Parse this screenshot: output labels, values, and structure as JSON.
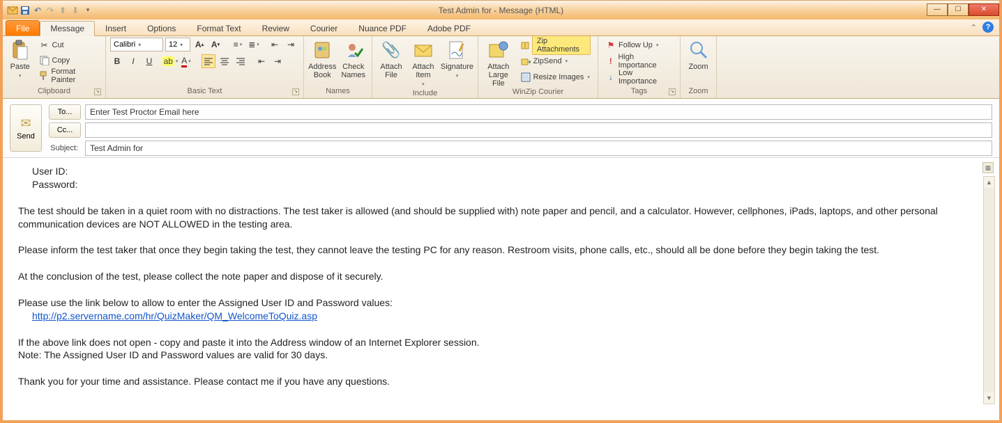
{
  "window": {
    "title": "Test Admin for  - Message (HTML)"
  },
  "tabs": {
    "file": "File",
    "items": [
      "Message",
      "Insert",
      "Options",
      "Format Text",
      "Review",
      "Courier",
      "Nuance PDF",
      "Adobe PDF"
    ],
    "active_index": 0
  },
  "ribbon": {
    "clipboard": {
      "label": "Clipboard",
      "paste": "Paste",
      "cut": "Cut",
      "copy": "Copy",
      "format_painter": "Format Painter"
    },
    "basictext": {
      "label": "Basic Text",
      "font_name": "Calibri",
      "font_size": "12"
    },
    "names": {
      "label": "Names",
      "address_book": "Address Book",
      "check_names": "Check Names"
    },
    "include": {
      "label": "Include",
      "attach_file": "Attach File",
      "attach_item": "Attach Item",
      "signature": "Signature"
    },
    "winzip": {
      "label": "WinZip Courier",
      "attach_large_file": "Attach Large File",
      "zip_attachments": "Zip Attachments",
      "zipsend": "ZipSend",
      "resize_images": "Resize Images"
    },
    "tags": {
      "label": "Tags",
      "follow_up": "Follow Up",
      "high_importance": "High Importance",
      "low_importance": "Low Importance"
    },
    "zoom": {
      "label": "Zoom",
      "zoom": "Zoom"
    }
  },
  "header": {
    "send": "Send",
    "to_btn": "To...",
    "cc_btn": "Cc...",
    "subject_lbl": "Subject:",
    "to_value": "Enter Test Proctor Email here",
    "cc_value": "",
    "subject_value": "Test Admin for"
  },
  "body": {
    "user_id_lbl": "User ID:",
    "password_lbl": "Password:",
    "para1": "The test should be taken in a quiet room with no distractions.  The test taker is allowed (and should be supplied with) note paper and pencil, and a calculator.  However, cellphones, iPads, laptops, and other personal communication devices are NOT ALLOWED in the testing area.",
    "para2": "Please inform the test taker that once they begin taking the test, they cannot leave the testing PC for any reason.  Restroom visits, phone calls, etc., should all be done before they begin taking the test.",
    "para3": "At the conclusion of the test, please collect the note paper and dispose of it securely.",
    "para4": "Please use the link below to allow  to enter the Assigned User ID and Password values:",
    "link": "http://p2.servername.com/hr/QuizMaker/QM_WelcomeToQuiz.asp",
    "para5": "If the above link does not open - copy and paste it into the Address window of an Internet Explorer session.",
    "para6": "Note:  The Assigned User ID and Password values are valid for 30 days.",
    "para7": "Thank you for your time and assistance.  Please contact me if you have any questions."
  }
}
